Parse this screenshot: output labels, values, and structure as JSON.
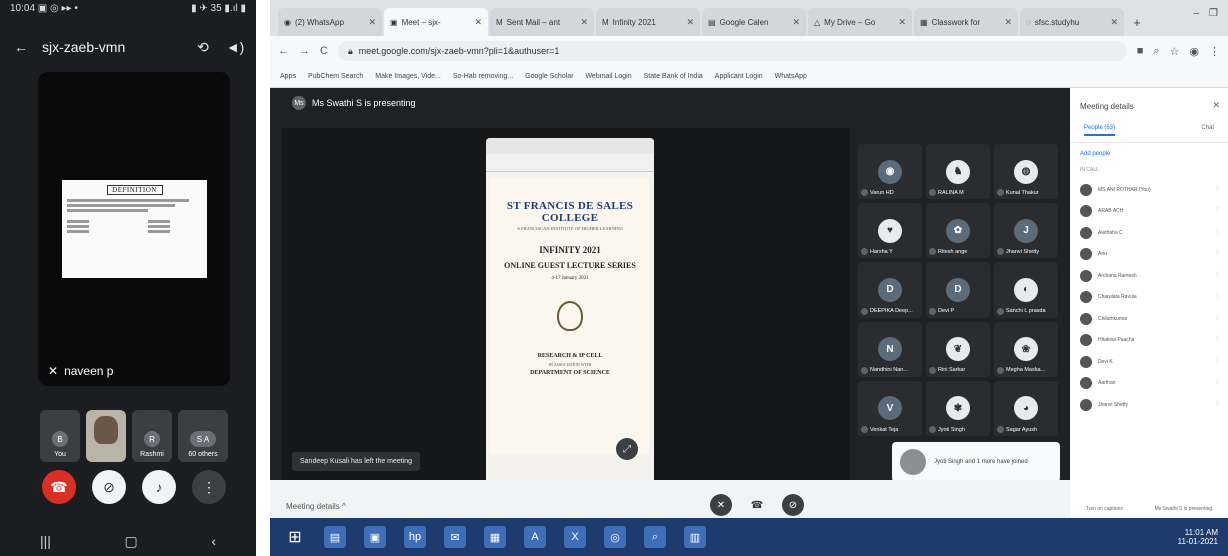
{
  "phone": {
    "status_left": "10:04 ▣ ◎ ▸▸ •",
    "status_right": "▮ ✈ 35 ▮.ıl ▮",
    "meeting_code": "sjx-zaeb-vmn",
    "slide_heading": "DEFINITION",
    "presenter_name": "naveen p",
    "tiles": [
      {
        "label": "You",
        "initial": "B"
      },
      {
        "label": "",
        "initial": ""
      },
      {
        "label": "Rashmi",
        "initial": "R"
      },
      {
        "label": "60 others",
        "initial": "S A"
      }
    ]
  },
  "browser": {
    "tabs": [
      {
        "label": "(2) WhatsApp"
      },
      {
        "label": "Meet – sjx-"
      },
      {
        "label": "Sent Mail – ant"
      },
      {
        "label": "Infinity 2021"
      },
      {
        "label": "Google Calen"
      },
      {
        "label": "My Drive – Go"
      },
      {
        "label": "Classwork for"
      },
      {
        "label": "sfsc.studyhu"
      }
    ],
    "url": "meet.google.com/sjx-zaeb-vmn?pli=1&authuser=1",
    "bookmarks": [
      "Apps",
      "PubChem Search",
      "Make Images, Vide...",
      "So-Hab removing...",
      "Google Scholar",
      "Webmail Login",
      "State Bank of India",
      "Applicant Login",
      "WhatsApp"
    ]
  },
  "meet": {
    "presenting_text": "Ms Swathi S is presenting",
    "presenting_initial": "Ms",
    "shared_doc": {
      "college": "ST FRANCIS DE SALES COLLEGE",
      "institution": "A FRANCISCAN INSTITUTE OF HIGHER LEARNING",
      "event": "INFINITY 2021",
      "series": "ONLINE GUEST LECTURE SERIES",
      "dates": "4-17 January 2021",
      "cell": "RESEARCH & IP CELL",
      "in_association": "IN ASSOCIATION WITH",
      "dept": "DEPARTMENT OF SCIENCE"
    },
    "toast": "Sandeep Kusali has left the meeting",
    "participants": [
      {
        "name": "",
        "initial": ""
      },
      {
        "name": "RALINA M",
        "initial": ""
      },
      {
        "name": "Kunal Thakur",
        "initial": ""
      },
      {
        "name": "Harsha Y",
        "initial": ""
      },
      {
        "name": "Ritesh ange",
        "initial": ""
      },
      {
        "name": "Jhanvi Shetty",
        "initial": "J"
      },
      {
        "name": "DEEPIKA Deep...",
        "initial": "D"
      },
      {
        "name": "Devi P",
        "initial": "D"
      },
      {
        "name": "Sanchi L prasda",
        "initial": ""
      },
      {
        "name": "Nandhini Nan...",
        "initial": "N"
      },
      {
        "name": "Rini Sarkar",
        "initial": ""
      },
      {
        "name": "Megha Maska...",
        "initial": ""
      },
      {
        "name": "Venkat Teja",
        "initial": "V"
      },
      {
        "name": "Jyoti Singh",
        "initial": ""
      },
      {
        "name": "Sagar Ayush",
        "initial": ""
      }
    ],
    "first_tile_name": "Varun HD",
    "popup_text": "Jyoti Singh and 1 more have joined",
    "meeting_details_label": "Meeting details"
  },
  "side_panel": {
    "title": "Meeting details",
    "tab_people": "People (63)",
    "tab_chat": "Chat",
    "add_people": "Add people",
    "in_call": "IN CALL",
    "people": [
      "MS ANI ROTHAR (You)",
      "ARAB ACH",
      "Alethaha C",
      "Anu",
      "Archana Ramesh",
      "Charulata Ravula",
      "Chilumkumar",
      "Hitakina Paacha",
      "Devi K",
      "Aarthan",
      "Jhanvi Shetty"
    ],
    "foot_left": "Turn on captions",
    "foot_right": "Ms Swathi S is presenting"
  },
  "taskbar": {
    "time": "11:01 AM",
    "date": "11-01-2021"
  }
}
